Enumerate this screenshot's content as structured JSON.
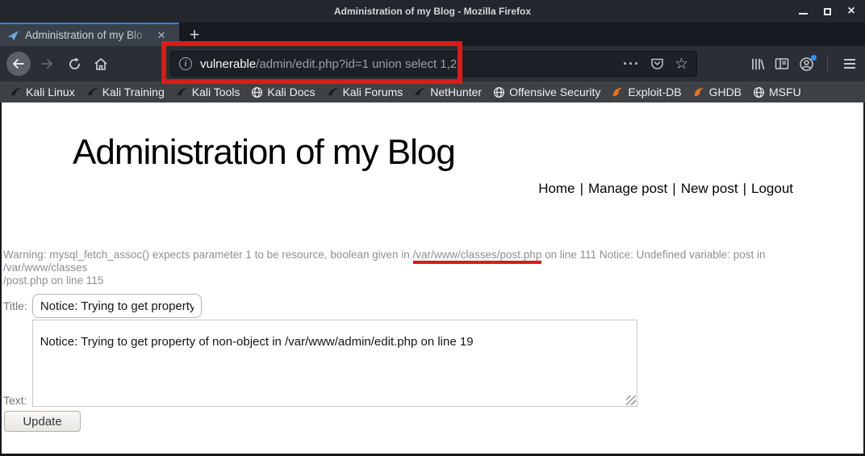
{
  "titlebar": {
    "title": "Administration of my Blog - Mozilla Firefox"
  },
  "tab": {
    "title": "Administration of my Blo",
    "close_glyph": "×",
    "new_tab_glyph": "+"
  },
  "window_controls": {
    "close_glyph": "×"
  },
  "navbar": {
    "url_host": "vulnerable",
    "url_rest": "/admin/edit.php?id=1 union select 1,2",
    "info_glyph": "i",
    "overflow_glyph": "···",
    "star_glyph": "☆"
  },
  "bookmarks": [
    {
      "label": "Kali Linux",
      "icon": "kali-dragon-icon"
    },
    {
      "label": "Kali Training",
      "icon": "kali-dragon-icon"
    },
    {
      "label": "Kali Tools",
      "icon": "kali-dragon-icon"
    },
    {
      "label": "Kali Docs",
      "icon": "globe-icon"
    },
    {
      "label": "Kali Forums",
      "icon": "kali-dragon-icon"
    },
    {
      "label": "NetHunter",
      "icon": "kali-dragon-icon"
    },
    {
      "label": "Offensive Security",
      "icon": "globe-icon"
    },
    {
      "label": "Exploit-DB",
      "icon": "exploitdb-bird-icon"
    },
    {
      "label": "GHDB",
      "icon": "exploitdb-bird-icon"
    },
    {
      "label": "MSFU",
      "icon": "globe-icon"
    }
  ],
  "page": {
    "heading": "Administration of my Blog",
    "nav_links": [
      "Home",
      "Manage post",
      "New post",
      "Logout"
    ],
    "nav_sep": "|",
    "warning": {
      "line1_pre": "Warning: mysql_fetch_assoc() expects parameter 1 to be resource, boolean given in ",
      "line1_path": "/var/www/classes/post.php",
      "line1_post": " on line 111 Notice: Undefined variable: post in /var/www/classes",
      "line2": "/post.php on line 115"
    },
    "form": {
      "title_label": "Title:",
      "title_value": "Notice: Trying to get property o",
      "text_label": "Text:",
      "text_value": "Notice: Trying to get property of non-object in /var/www/admin/edit.php on line 19",
      "update_label": "Update"
    }
  },
  "colors": {
    "annotation_red": "#d61c1c",
    "tab_accent_blue": "#3083d8",
    "exploitdb_orange": "#ee7220",
    "account_badge_blue": "#2f8fff"
  }
}
